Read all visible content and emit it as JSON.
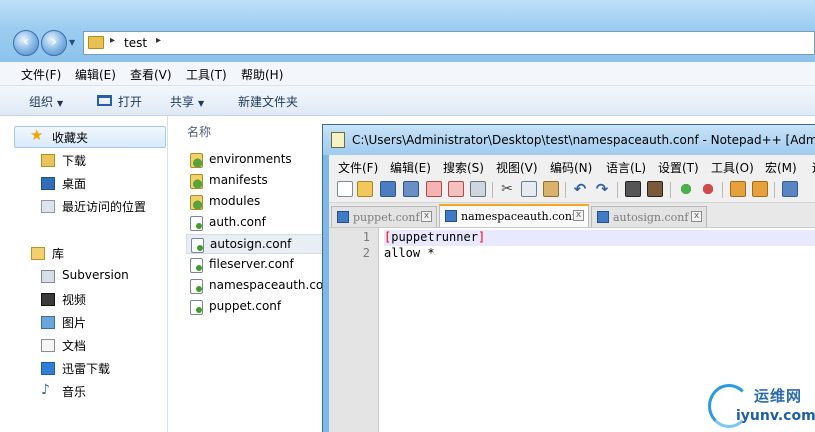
{
  "explorer": {
    "address": {
      "crumb": "test",
      "sep": "▸"
    },
    "menu": [
      "文件(F)",
      "编辑(E)",
      "查看(V)",
      "工具(T)",
      "帮助(H)"
    ],
    "toolbar": {
      "organize": "组织",
      "open": "打开",
      "share": "共享",
      "new_folder": "新建文件夹"
    },
    "sidebar": {
      "favorites": "收藏夹",
      "fav_items": [
        "下载",
        "桌面",
        "最近访问的位置"
      ],
      "library": "库",
      "lib_items": [
        "Subversion",
        "视频",
        "图片",
        "文档",
        "迅雷下载",
        "音乐"
      ]
    },
    "content": {
      "column_name": "名称",
      "files": [
        {
          "name": "environments",
          "type": "folder"
        },
        {
          "name": "manifests",
          "type": "folder"
        },
        {
          "name": "modules",
          "type": "folder"
        },
        {
          "name": "auth.conf",
          "type": "conf"
        },
        {
          "name": "autosign.conf",
          "type": "conf"
        },
        {
          "name": "fileserver.conf",
          "type": "conf"
        },
        {
          "name": "namespaceauth.conf",
          "type": "conf"
        },
        {
          "name": "puppet.conf",
          "type": "conf"
        }
      ]
    }
  },
  "npp": {
    "title": "C:\\Users\\Administrator\\Desktop\\test\\namespaceauth.conf - Notepad++ [Admin",
    "menu": [
      "文件(F)",
      "编辑(E)",
      "搜索(S)",
      "视图(V)",
      "编码(N)",
      "语言(L)",
      "设置(T)",
      "工具(O)",
      "宏(M)",
      "运"
    ],
    "tabs": [
      {
        "label": "puppet.conf",
        "active": false
      },
      {
        "label": "namespaceauth.conf",
        "active": true
      },
      {
        "label": "autosign.conf",
        "active": false
      }
    ],
    "tab_close": "x",
    "lines": [
      {
        "num": "1",
        "bracket_open": "[",
        "text": "puppetrunner",
        "bracket_close": "]"
      },
      {
        "num": "2",
        "text": "allow *"
      }
    ]
  },
  "watermark": {
    "cn": "运维网",
    "url": "iyunv.com"
  }
}
